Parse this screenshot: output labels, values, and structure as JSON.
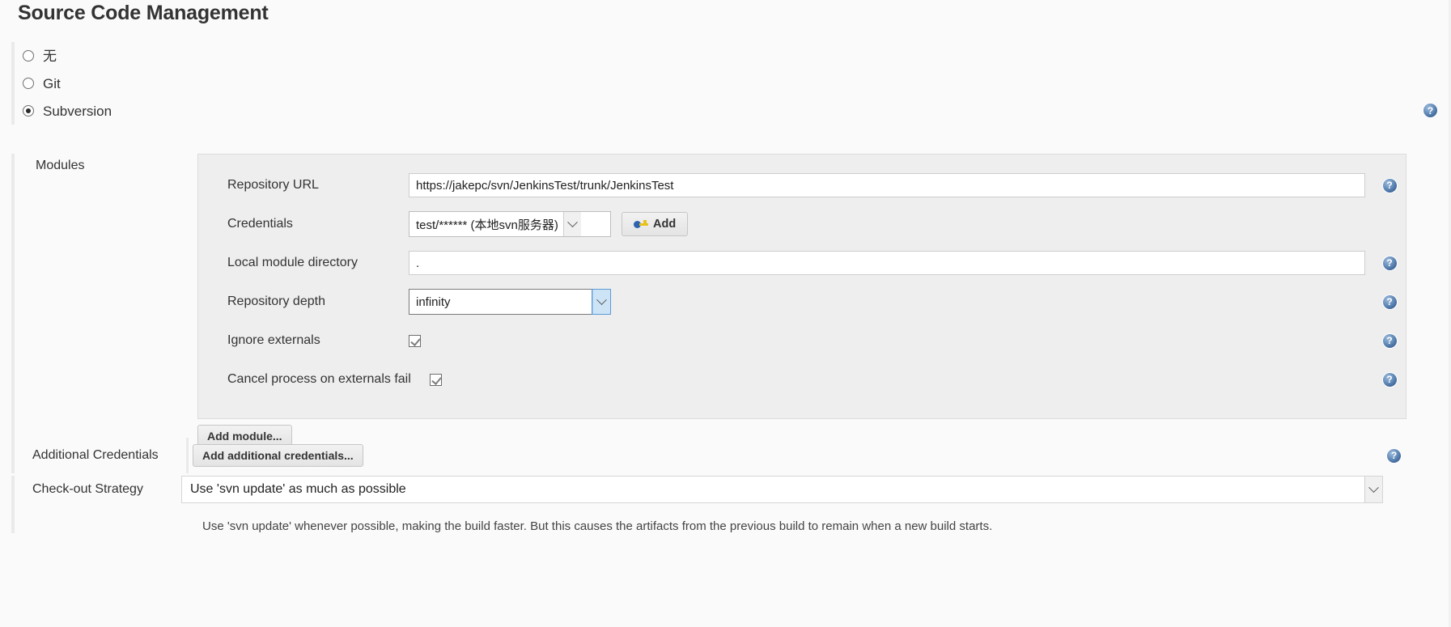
{
  "page": {
    "title": "Source Code Management"
  },
  "scm": {
    "options": [
      {
        "label": "无",
        "selected": false,
        "name": "scm-option-none"
      },
      {
        "label": "Git",
        "selected": false,
        "name": "scm-option-git"
      },
      {
        "label": "Subversion",
        "selected": true,
        "name": "scm-option-subversion"
      }
    ],
    "help_icon": "help-icon"
  },
  "modules": {
    "label": "Modules",
    "fields": {
      "repository_url": {
        "label": "Repository URL",
        "value": "https://jakepc/svn/JenkinsTest/trunk/JenkinsTest",
        "placeholder": ""
      },
      "credentials": {
        "label": "Credentials",
        "value": "test/****** (本地svn服务器)",
        "add_button": "Add",
        "add_button_icon": "key-icon"
      },
      "local_module_directory": {
        "label": "Local module directory",
        "value": ".",
        "placeholder": ""
      },
      "repository_depth": {
        "label": "Repository depth",
        "value": "infinity"
      },
      "ignore_externals": {
        "label": "Ignore externals",
        "checked": true
      },
      "cancel_process_on_externals_fail": {
        "label": "Cancel process on externals fail",
        "checked": true
      }
    },
    "add_module_button": "Add module..."
  },
  "additional_credentials": {
    "label": "Additional Credentials",
    "button": "Add additional credentials..."
  },
  "checkout_strategy": {
    "label": "Check-out Strategy",
    "value": "Use 'svn update' as much as possible",
    "description": "Use 'svn update' whenever possible, making the build faster. But this causes the artifacts from the previous build to remain when a new build starts."
  },
  "colors": {
    "help_blue": "#5d86b4",
    "panel_gray": "#eeeeee",
    "page_bg": "#fafafa",
    "focus_blue": "#cde4f7"
  }
}
